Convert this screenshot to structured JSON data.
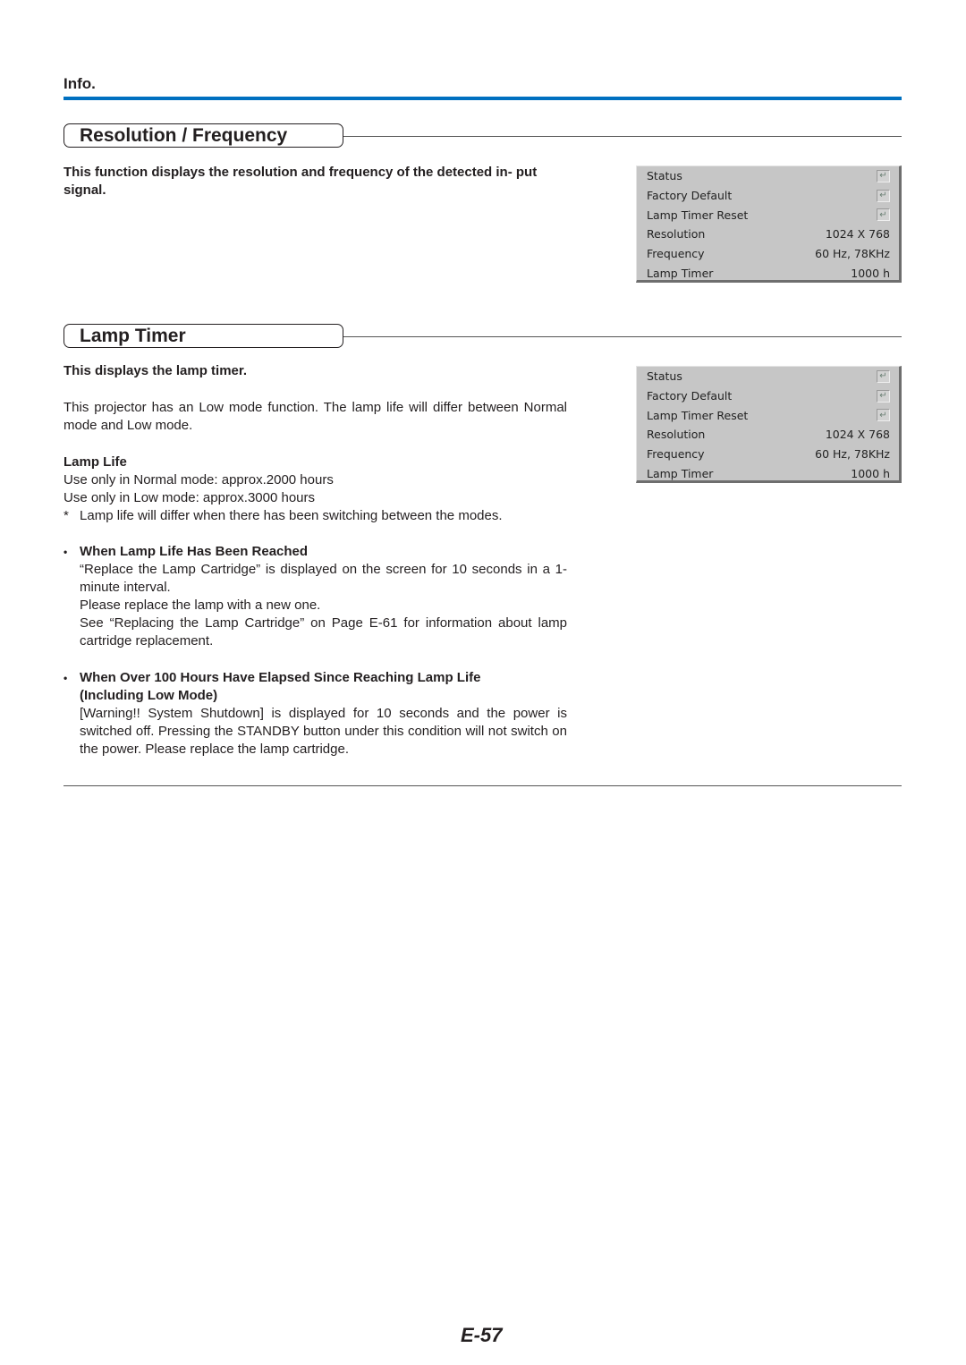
{
  "header": {
    "section_label": "Info."
  },
  "resolution_section": {
    "title": "Resolution / Frequency",
    "description": "This function displays the resolution and frequency of the detected in- put signal."
  },
  "osd_menu": {
    "rows": [
      {
        "label": "Status",
        "value": null,
        "icon": "enter-icon"
      },
      {
        "label": "Factory Default",
        "value": null,
        "icon": "enter-icon"
      },
      {
        "label": "Lamp Timer Reset",
        "value": null,
        "icon": "enter-icon"
      },
      {
        "label": "Resolution",
        "value": "1024 X 768"
      },
      {
        "label": "Frequency",
        "value": "60 Hz, 78KHz"
      },
      {
        "label": "Lamp Timer",
        "value": "1000 h"
      }
    ],
    "enter_glyph": "↵"
  },
  "lamp_section": {
    "title": "Lamp Timer",
    "subtitle": "This displays the lamp timer.",
    "intro": "This projector has an Low mode function. The lamp life will differ between Normal mode and Low mode.",
    "lamp_life_heading": "Lamp Life",
    "normal_mode": "Use only in Normal mode: approx.2000 hours",
    "low_mode": "Use only in Low mode: approx.3000 hours",
    "note_mark": "*",
    "note": "Lamp life will differ when there has been switching between the modes.",
    "bullets": [
      {
        "marker": "•",
        "heading": "When Lamp Life Has Been Reached",
        "lines": [
          "“Replace the Lamp Cartridge” is displayed on the screen for 10 seconds in a 1-minute interval.",
          "Please replace the lamp with a new one.",
          "See “Replacing the Lamp Cartridge” on Page E-61 for information about lamp cartridge replacement."
        ]
      },
      {
        "marker": "•",
        "heading": "When Over 100 Hours Have Elapsed Since Reaching Lamp Life (Including Low Mode)",
        "lines": [
          "[Warning!! System Shutdown] is displayed for 10 seconds and the power is switched off. Pressing the STANDBY button under this condition will not switch on the power. Please replace the lamp cartridge."
        ]
      }
    ]
  },
  "footer": {
    "page_number": "E-57"
  },
  "colors": {
    "accent_rule": "#0070c0",
    "osd_background": "#c6c6c6"
  }
}
